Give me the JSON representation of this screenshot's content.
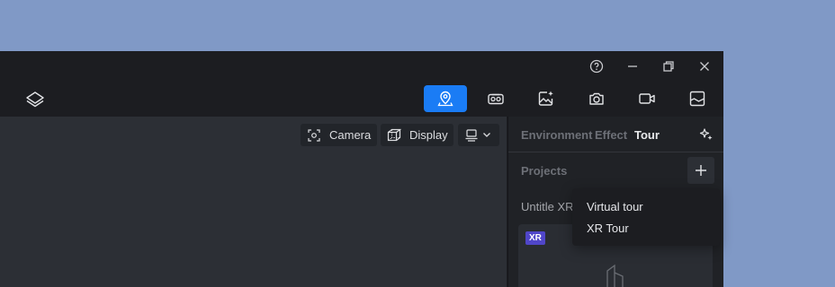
{
  "window_controls": {
    "help_icon": "question-circle-icon",
    "minimize_icon": "minimize-icon",
    "restore_icon": "restore-icon",
    "close_icon": "close-icon"
  },
  "toolbar": {
    "logo_icon": "layers-logo-icon",
    "tools": [
      {
        "icon": "map-pin-icon",
        "active": true
      },
      {
        "icon": "vr-headset-icon",
        "active": false
      },
      {
        "icon": "image-sparkle-icon",
        "active": false
      },
      {
        "icon": "camera-icon",
        "active": false
      },
      {
        "icon": "video-camera-icon",
        "active": false
      },
      {
        "icon": "picture-frame-icon",
        "active": false
      }
    ],
    "active_color": "#1a7cf5"
  },
  "viewport": {
    "camera_label": "Camera",
    "display_label": "Display"
  },
  "panel": {
    "tabs": [
      {
        "label": "Environment",
        "active": false
      },
      {
        "label": "Effect",
        "active": false
      },
      {
        "label": "Tour",
        "active": true
      }
    ],
    "projects_label": "Projects",
    "project_name": "Untitle XR",
    "card_badge": "XR",
    "badge_color": "#5046c9"
  },
  "dropdown": {
    "items": [
      "Virtual tour",
      "XR Tour"
    ]
  }
}
